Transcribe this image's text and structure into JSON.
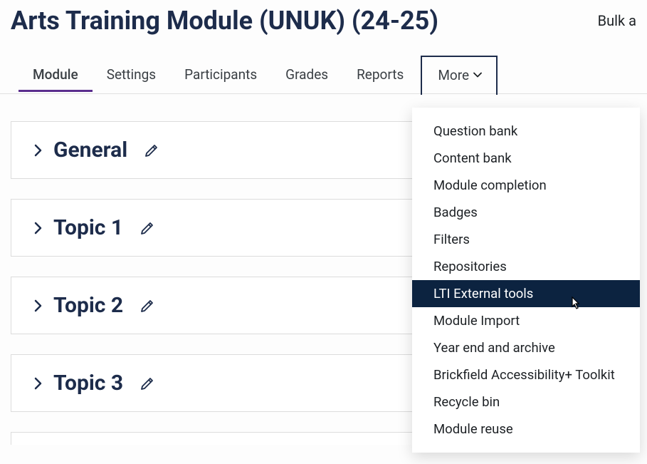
{
  "header": {
    "title": "Arts Training Module (UNUK) (24-25)",
    "bulk_label": "Bulk a"
  },
  "tabs": [
    {
      "label": "Module",
      "active": true
    },
    {
      "label": "Settings",
      "active": false
    },
    {
      "label": "Participants",
      "active": false
    },
    {
      "label": "Grades",
      "active": false
    },
    {
      "label": "Reports",
      "active": false
    }
  ],
  "more_tab_label": "More",
  "dropdown_items": [
    {
      "label": "Question bank",
      "highlighted": false
    },
    {
      "label": "Content bank",
      "highlighted": false
    },
    {
      "label": "Module completion",
      "highlighted": false
    },
    {
      "label": "Badges",
      "highlighted": false
    },
    {
      "label": "Filters",
      "highlighted": false
    },
    {
      "label": "Repositories",
      "highlighted": false
    },
    {
      "label": "LTI External tools",
      "highlighted": true
    },
    {
      "label": "Module Import",
      "highlighted": false
    },
    {
      "label": "Year end and archive",
      "highlighted": false
    },
    {
      "label": "Brickfield Accessibility+ Toolkit",
      "highlighted": false
    },
    {
      "label": "Recycle bin",
      "highlighted": false
    },
    {
      "label": "Module reuse",
      "highlighted": false
    }
  ],
  "sections": [
    {
      "title": "General"
    },
    {
      "title": "Topic 1"
    },
    {
      "title": "Topic 2"
    },
    {
      "title": "Topic 3"
    }
  ]
}
